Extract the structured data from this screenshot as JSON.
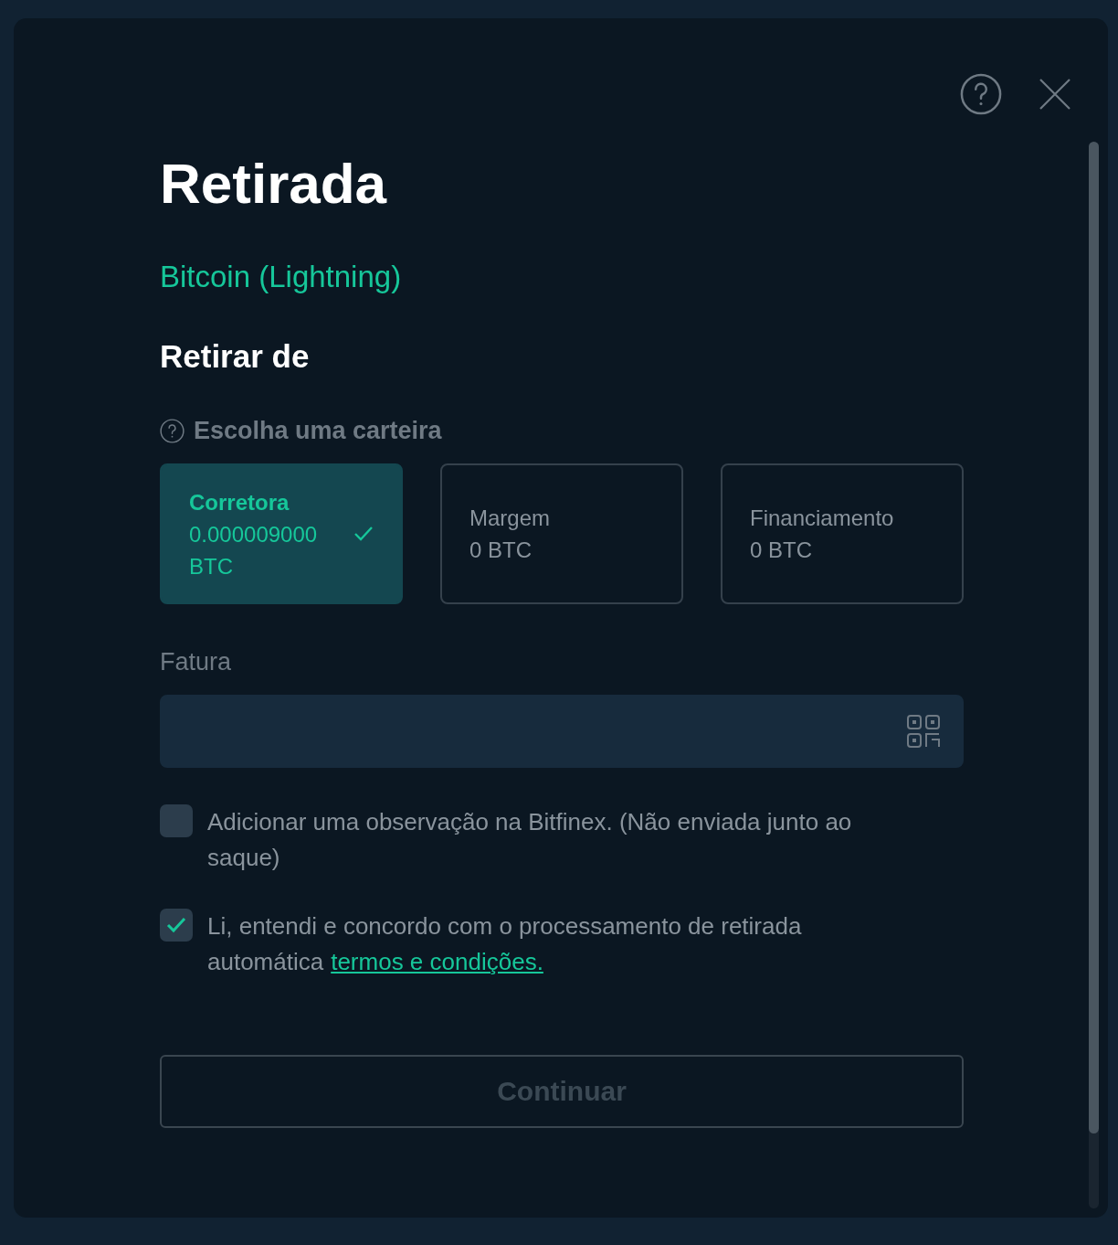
{
  "title": "Retirada",
  "asset": "Bitcoin (Lightning)",
  "section_title": "Retirar de",
  "wallet_prompt": "Escolha uma carteira",
  "wallets": [
    {
      "name": "Corretora",
      "balance": "0.000009000 BTC",
      "selected": true
    },
    {
      "name": "Margem",
      "balance": "0 BTC",
      "selected": false
    },
    {
      "name": "Financiamento",
      "balance": "0 BTC",
      "selected": false
    }
  ],
  "invoice": {
    "label": "Fatura"
  },
  "options": [
    {
      "text": "Adicionar uma observação na Bitfinex. (Não enviada junto ao saque)",
      "checked": false
    },
    {
      "text": "Li, entendi e concordo com o processamento de retirada automática",
      "link": "termos e condições.",
      "checked": true
    }
  ],
  "submit": {
    "label": "Continuar",
    "disabled": true
  }
}
